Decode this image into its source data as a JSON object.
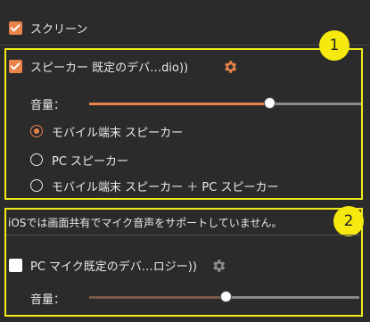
{
  "screen": {
    "label": "スクリーン",
    "checked": true
  },
  "speaker_section": {
    "badge": "1",
    "checked": true,
    "label": "スピーカー   既定のデバ…dio))",
    "icon": "gear-icon",
    "volume_label": "音量：",
    "volume_level": 0.72,
    "options": [
      {
        "label": "モバイル端末 スピーカー",
        "selected": true
      },
      {
        "label": "PC スピーカー",
        "selected": false
      },
      {
        "label": "モバイル端末 スピーカー ＋ PC スピーカー",
        "selected": false
      }
    ]
  },
  "mic_section": {
    "badge": "2",
    "notice": "iOSでは画面共有でマイク音声をサポートしていません。",
    "checked": false,
    "label": "PC マイク既定のデバ…ロジー))",
    "icon": "gear-icon",
    "volume_label": "音量：",
    "volume_level": 0.5
  },
  "colors": {
    "accent": "#e8834a",
    "highlight": "#f1ea1a",
    "muted_accent": "#7a5a48"
  }
}
